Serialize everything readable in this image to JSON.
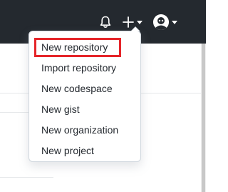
{
  "header": {
    "icons": {
      "notifications": "bell-icon",
      "create": "plus-icon",
      "avatar": "avatar-icon"
    }
  },
  "create_menu": {
    "items": [
      {
        "label": "New repository",
        "highlighted": true
      },
      {
        "label": "Import repository"
      },
      {
        "label": "New codespace"
      },
      {
        "label": "New gist"
      },
      {
        "label": "New organization"
      },
      {
        "label": "New project"
      }
    ],
    "highlight_color": "#e5252a"
  },
  "colors": {
    "header_bg": "#24292f",
    "text": "#24292f",
    "menu_border": "#d0d7de"
  }
}
